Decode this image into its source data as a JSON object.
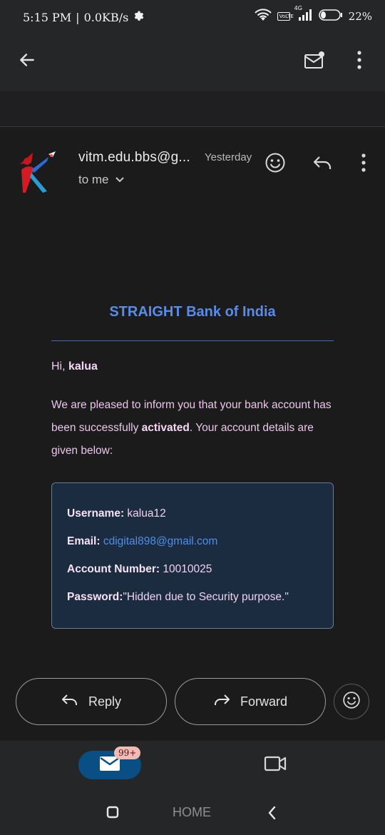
{
  "status_bar": {
    "time": "5:15 PM",
    "speed": "0.0KB/s",
    "network": "4G",
    "volte": "VoLTE",
    "battery": "22%"
  },
  "app_bar": {
    "back_icon": "arrow-left-icon",
    "mark_unread_icon": "mail-unread-icon",
    "more_icon": "more-vertical-icon"
  },
  "email": {
    "sender": "vitm.edu.bbs@g...",
    "time": "Yesterday",
    "recipient": "to me",
    "bank_name": "STRAIGHT Bank of India",
    "greeting_prefix": "Hi, ",
    "greeting_name": "kalua",
    "paragraph_part1": "We are pleased to inform you that your bank account has been successfully ",
    "paragraph_bold": "activated",
    "paragraph_part2": ". Your account details are given below:",
    "details": {
      "username_label": "Username:",
      "username_value": " kalua12",
      "email_label": "Email:",
      "email_value": "cdigital898@gmail.com",
      "account_label": "Account Number:",
      "account_value": " 10010025",
      "password_label": "Password:",
      "password_value": "\"Hidden due to Security purpose.\""
    }
  },
  "actions": {
    "reply_label": "Reply",
    "forward_label": "Forward"
  },
  "bottom_nav": {
    "mail_badge": "99+"
  },
  "system_nav": {
    "home_label": "HOME"
  },
  "colors": {
    "background": "#1b1b1c",
    "bar": "#252628",
    "accent_blue": "#5b8be8",
    "text_pink": "#eac7ea",
    "card_bg": "#1b2b40",
    "mail_pill": "#0a4f83",
    "badge": "#f4b9b4"
  }
}
